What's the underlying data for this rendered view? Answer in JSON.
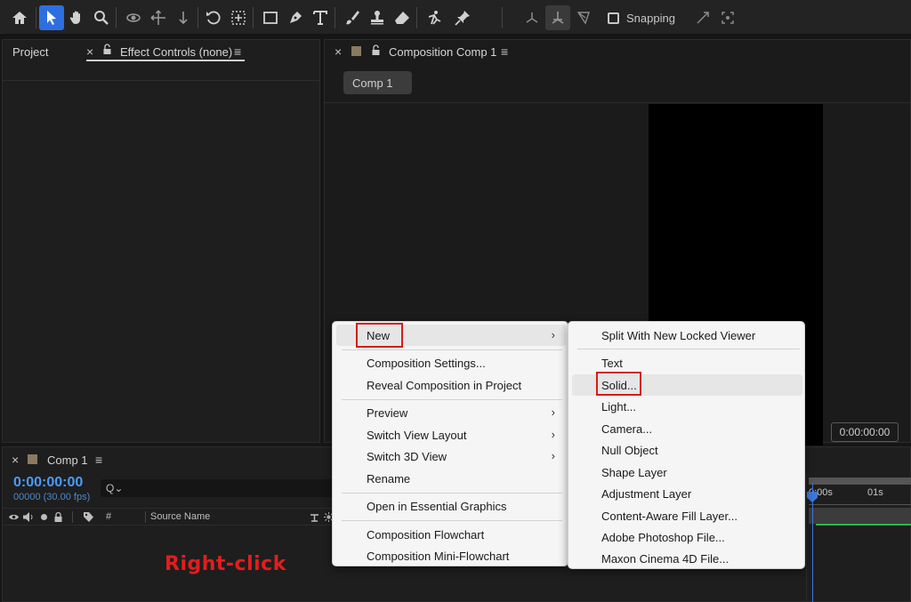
{
  "toolbar": {
    "tools": [
      "home-icon",
      "selection-arrow-icon",
      "hand-icon",
      "zoom-icon",
      "orbit-camera-icon",
      "pan-camera-icon",
      "dolly-camera-icon",
      "rotate-icon",
      "pan-behind-icon",
      "rectangle-icon",
      "pen-icon",
      "type-icon",
      "brush-icon",
      "clone-stamp-icon",
      "eraser-icon",
      "roto-brush-icon",
      "puppet-pin-icon",
      "local-axis-icon",
      "world-axis-icon",
      "view-axis-icon",
      "snap-edges-icon",
      "snap-features-icon"
    ],
    "snapping_label": "Snapping"
  },
  "left_panel": {
    "tab_project": "Project",
    "tab_close": "×",
    "tab_effect_controls": "Effect Controls (none)",
    "menu_icon": "≡"
  },
  "comp_panel": {
    "tab_close": "×",
    "tab_title": "Composition Comp 1",
    "menu_icon": "≡",
    "comp_tab_label": "Comp 1",
    "timecode": "0:00:00:00"
  },
  "timeline": {
    "tab_close": "×",
    "tab_title": "Comp 1",
    "menu_icon": "≡",
    "timecode": "0:00:00:00",
    "fps": "00000 (30.00 fps)",
    "search_placeholder": "Q⌄",
    "col_hash": "#",
    "col_source_name": "Source Name",
    "ruler_0": "0:00s",
    "ruler_1": "01s",
    "annotation": "Right-click"
  },
  "context_menu": {
    "items": [
      {
        "label": "New",
        "submenu": true
      },
      {
        "label": "Composition Settings...",
        "submenu": false
      },
      {
        "label": "Reveal Composition in Project",
        "submenu": false
      },
      {
        "label": "Preview",
        "submenu": true
      },
      {
        "label": "Switch View Layout",
        "submenu": true
      },
      {
        "label": "Switch 3D View",
        "submenu": true
      },
      {
        "label": "Rename",
        "submenu": false
      },
      {
        "label": "Open in Essential Graphics",
        "submenu": false
      },
      {
        "label": "Composition Flowchart",
        "submenu": false
      },
      {
        "label": "Composition Mini-Flowchart",
        "submenu": false
      }
    ],
    "arrow": "›"
  },
  "submenu_new": {
    "items": [
      "Split With New Locked Viewer",
      "Text",
      "Solid...",
      "Light...",
      "Camera...",
      "Null Object",
      "Shape Layer",
      "Adjustment Layer",
      "Content-Aware Fill Layer...",
      "Adobe Photoshop File...",
      "Maxon Cinema 4D File..."
    ]
  },
  "colors": {
    "accent_blue": "#2d6fe0",
    "timecode_blue": "#4a9cff",
    "annotation_red": "#e21d1d",
    "highlight_box": "#d61b1b"
  }
}
